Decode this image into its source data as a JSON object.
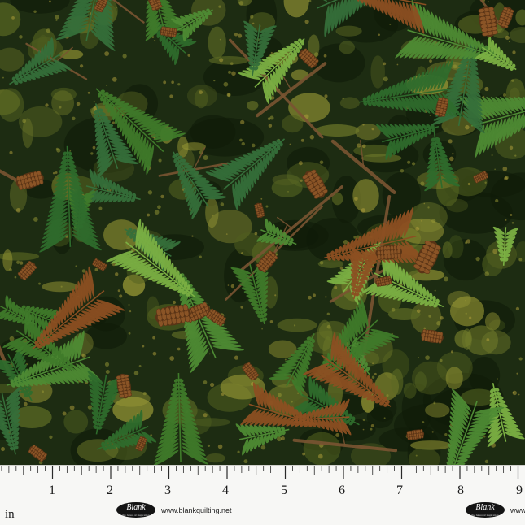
{
  "image": {
    "subject": "forest floor print fabric swatch",
    "palette": {
      "base": "#1d2c12",
      "deep": "#0f1a09",
      "fern": "#3f7a2a",
      "fern_light": "#7bb043",
      "moss": "#6f7a2a",
      "moss_bright": "#9a9a36",
      "cone": "#8a5426",
      "cone_dark": "#5a3416",
      "twig": "#7a5432"
    }
  },
  "ruler": {
    "numbers": [
      "1",
      "2",
      "3",
      "4",
      "5",
      "6",
      "7",
      "8",
      "9"
    ],
    "unit": "in",
    "logo_text": "Blank",
    "logo_tagline": "the future of inspiration",
    "url": "www.blankquilting.net",
    "url_short": "www"
  }
}
